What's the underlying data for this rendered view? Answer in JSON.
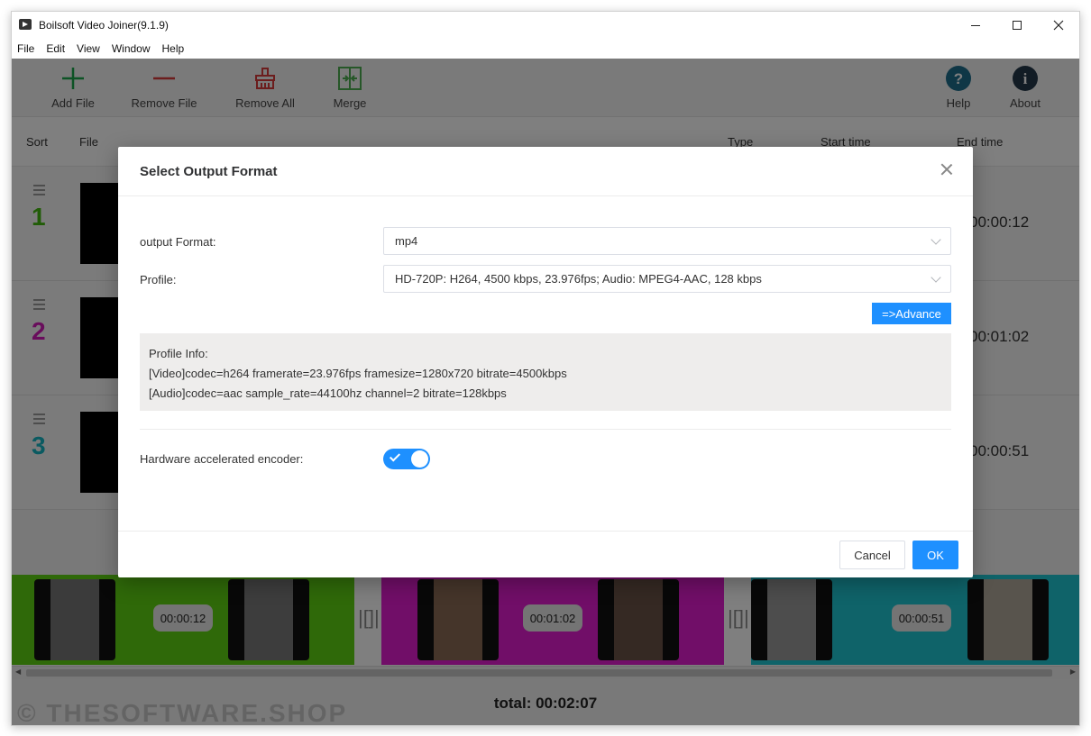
{
  "window": {
    "title": "Boilsoft Video Joiner(9.1.9)"
  },
  "menu": [
    "File",
    "Edit",
    "View",
    "Window",
    "Help"
  ],
  "toolbar": {
    "add_file": "Add File",
    "remove_file": "Remove File",
    "remove_all": "Remove All",
    "merge": "Merge",
    "help": "Help",
    "about": "About"
  },
  "list_header": {
    "sort": "Sort",
    "file": "File",
    "type": "Type",
    "start_time": "Start time",
    "end_time": "End time"
  },
  "rows": [
    {
      "number": "1",
      "end_time": "00:00:12",
      "color": "#43b80f"
    },
    {
      "number": "2",
      "end_time": "00:01:02",
      "color": "#d21ab8"
    },
    {
      "number": "3",
      "end_time": "00:00:51",
      "color": "#14b5c2"
    }
  ],
  "timeline": {
    "clips": [
      {
        "duration": "00:00:12",
        "color": "#5fd313"
      },
      {
        "duration": "00:01:02",
        "color": "#e21cd0"
      },
      {
        "duration": "00:00:51",
        "color": "#1ec7d2"
      }
    ],
    "divider": "|[]|"
  },
  "status": {
    "total": "total: 00:02:07",
    "watermark": "© THESOFTWARE.SHOP"
  },
  "dialog": {
    "title": "Select Output Format",
    "output_format_label": "output Format:",
    "output_format_value": "mp4",
    "profile_label": "Profile:",
    "profile_value": "HD-720P: H264, 4500 kbps, 23.976fps; Audio: MPEG4-AAC, 128 kbps",
    "advance_label": "=>Advance",
    "profile_info_title": "Profile Info:",
    "profile_info_video": "[Video]codec=h264 framerate=23.976fps framesize=1280x720 bitrate=4500kbps",
    "profile_info_audio": "[Audio]codec=aac sample_rate=44100hz channel=2 bitrate=128kbps",
    "hw_encoder_label": "Hardware accelerated encoder:",
    "hw_encoder_enabled": true,
    "cancel_label": "Cancel",
    "ok_label": "OK"
  },
  "colors": {
    "accent": "#1e90ff"
  }
}
